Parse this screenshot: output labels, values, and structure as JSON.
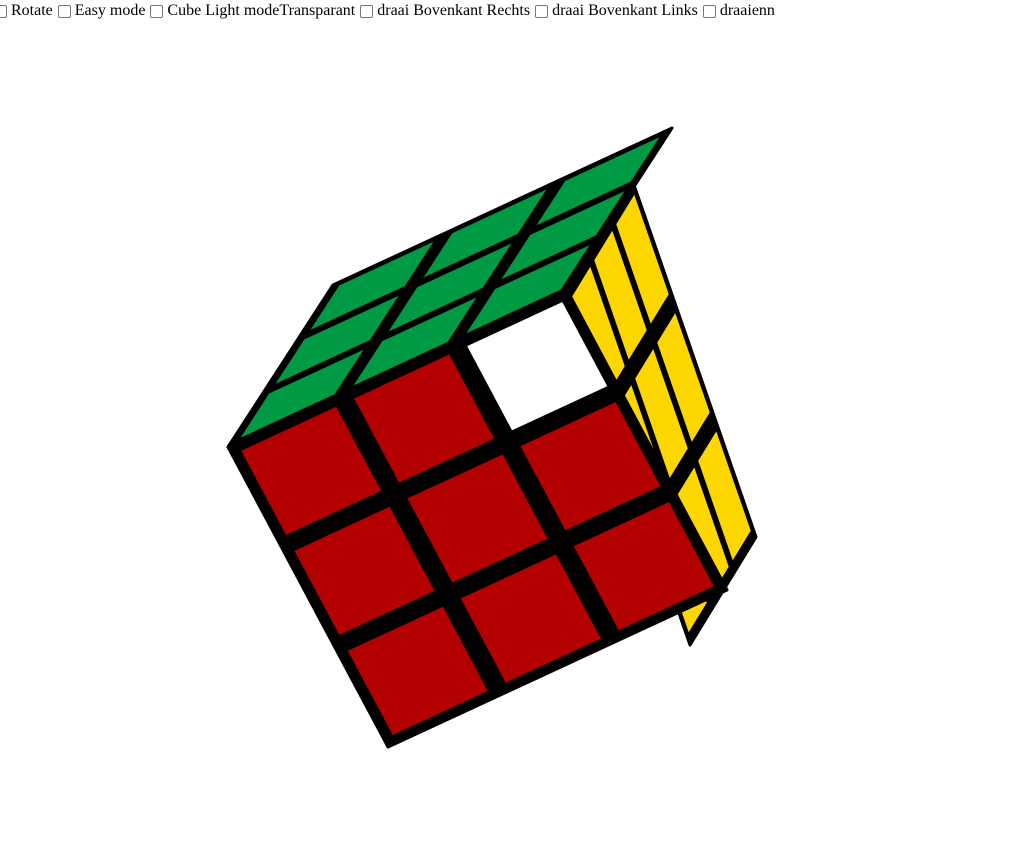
{
  "controls": [
    {
      "id": "rotate",
      "label": "Rotate",
      "checked": false,
      "has_checkbox": true
    },
    {
      "id": "easy",
      "label": "Easy mode",
      "checked": false,
      "has_checkbox": true
    },
    {
      "id": "light",
      "label": "Cube Light modeTransparant",
      "checked": false,
      "has_checkbox": true
    },
    {
      "id": "rr",
      "label": "draai Bovenkant Rechts",
      "checked": false,
      "has_checkbox": true
    },
    {
      "id": "rl",
      "label": "draai Bovenkant Links",
      "checked": false,
      "has_checkbox": true
    },
    {
      "id": "dr",
      "label": "draaienn",
      "checked": false,
      "has_checkbox": true
    }
  ],
  "cube": {
    "colors": {
      "top": "#009944",
      "front": "#b30000",
      "side": "#ffd700",
      "hole": "#ffffff",
      "edge": "#000000"
    },
    "top_face": [
      [
        "green",
        "green",
        "green"
      ],
      [
        "green",
        "green",
        "green"
      ],
      [
        "green",
        "green",
        "green"
      ]
    ],
    "front_face": [
      [
        "red",
        "red",
        "white"
      ],
      [
        "red",
        "red",
        "red"
      ],
      [
        "red",
        "red",
        "red"
      ]
    ],
    "side_face": [
      [
        "yellow",
        "yellow",
        "yellow"
      ],
      [
        "yellow",
        "yellow",
        "yellow"
      ],
      [
        "yellow",
        "yellow",
        "yellow"
      ]
    ]
  }
}
